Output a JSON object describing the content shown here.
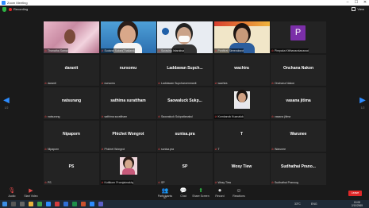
{
  "window": {
    "title": "Zoom Meeting",
    "minimize": "–",
    "maximize": "☐",
    "close": "✕"
  },
  "recording": {
    "label": "Recording"
  },
  "view": {
    "label": "View"
  },
  "pagination": {
    "left": "1/2",
    "right": "1/2"
  },
  "tiles": [
    {
      "center": "",
      "footer": "Thanatha Samai",
      "type": "photo-pink"
    },
    {
      "center": "",
      "footer": "Sudarat Suksri(Thailand)",
      "type": "photo-woman-blue"
    },
    {
      "center": "",
      "footer": "Surasing Intaraksa",
      "type": "photo-masked"
    },
    {
      "center": "",
      "footer": "Panittrat Sireeraksrot",
      "type": "photo-banner"
    },
    {
      "center": "",
      "footer": "Pimpaka Kitthanaratanawat",
      "type": "avatar",
      "letter": "P"
    },
    {
      "center": "daranit",
      "footer": "daranit",
      "type": "name"
    },
    {
      "center": "nursomu",
      "footer": "nursomu",
      "type": "name"
    },
    {
      "center": "Laddawan Supch...",
      "footer": "Laddawan Supcharoenmanit",
      "type": "name"
    },
    {
      "center": "wachira",
      "footer": "wachira",
      "type": "name"
    },
    {
      "center": "Onchana Nakon",
      "footer": "Onchana Nakon",
      "type": "name"
    },
    {
      "center": "natsurang",
      "footer": "natsurang",
      "type": "name"
    },
    {
      "center": "sathima surattham",
      "footer": "sathima surattham",
      "type": "name"
    },
    {
      "center": "Saowaluck Sukp...",
      "footer": "Saowaluck Sukpattanakul",
      "type": "name"
    },
    {
      "center": "",
      "footer": "Kornkanok Kuanaluk",
      "type": "photo-portrait"
    },
    {
      "center": "vasana jitima",
      "footer": "vasana jitima",
      "type": "name"
    },
    {
      "center": "Nipaporn",
      "footer": "Nipaporn",
      "type": "name"
    },
    {
      "center": "Phichet Wongrot",
      "footer": "Phichet Wongrot",
      "type": "name"
    },
    {
      "center": "sunisa.pra",
      "footer": "sunisa.pra",
      "type": "name"
    },
    {
      "center": "T",
      "footer": "T",
      "type": "name"
    },
    {
      "center": "Warunee",
      "footer": "Warunee",
      "type": "name"
    },
    {
      "center": "PS",
      "footer": "PS",
      "type": "name"
    },
    {
      "center": "",
      "footer": "Kuttikorn Promjaimakhy",
      "type": "photo-small"
    },
    {
      "center": "SP",
      "footer": "SP",
      "type": "name"
    },
    {
      "center": "Wosy Tiew",
      "footer": "Wosy Tiew",
      "type": "name"
    },
    {
      "center": "Sudhathai Prano...",
      "footer": "Sudhathai Pranoog",
      "type": "name"
    }
  ],
  "toolbar": {
    "audio": "Audio",
    "start_video": "Start Video",
    "participants": "Participants",
    "participants_count": "47",
    "chat": "Chat",
    "share_screen": "Share Screen",
    "record": "Record",
    "reactions": "Reactions",
    "leave": "Leave"
  },
  "taskbar": {
    "weather": "33°C",
    "lang": "ENG",
    "time": "15:08",
    "date": "2/10/2565"
  },
  "colors": {
    "accent": "#2d8cff",
    "leave": "#e02828",
    "share": "#2fb344",
    "avatar": "#7b2fa8"
  }
}
